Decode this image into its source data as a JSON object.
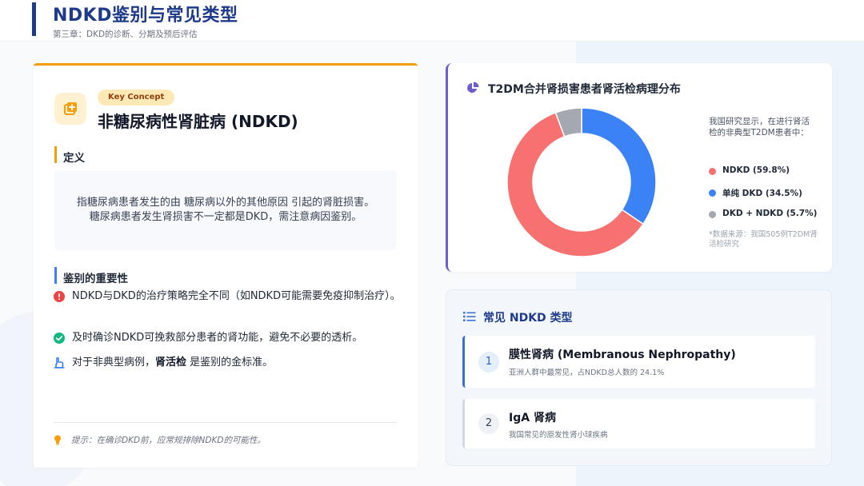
{
  "header": {
    "title": "NDKD鉴别与常见类型",
    "subtitle": "第三章：DKD的诊断、分期及预后评估"
  },
  "concept": {
    "badge": "Key Concept",
    "title": "非糖尿病性肾脏病 (NDKD)",
    "icon": "plus-square-icon"
  },
  "definition": {
    "heading": "定义",
    "line1": "指糖尿病患者发生的由 糖尿病以外的其他原因 引起的肾脏损害。",
    "line2": "糖尿病患者发生肾损害不一定都是DKD，需注意病因鉴别。"
  },
  "importance": {
    "heading": "鉴别的重要性",
    "items": [
      {
        "icon": "exclamation-circle-icon",
        "color": "#ef4444",
        "text": "NDKD与DKD的治疗策略完全不同（如NDKD可能需要免疫抑制治疗）。"
      },
      {
        "icon": "check-circle-icon",
        "color": "#10b981",
        "text": "及时确诊NDKD可挽救部分患者的肾功能，避免不必要的透析。"
      },
      {
        "icon": "hand-pointer-icon",
        "color": "#3b82f6",
        "text_pre": "对于非典型病例，",
        "text_bold": "肾活检",
        "text_post": " 是鉴别的金标准。"
      }
    ]
  },
  "tip": {
    "icon": "lightbulb-icon",
    "text": "提示：在确诊DKD前，应常规排除NDKD的可能性。"
  },
  "chart_card": {
    "title": "T2DM合并肾损害患者肾活检病理分布",
    "icon": "pie-chart-icon",
    "note": "我国研究显示，在进行肾活检的非典型T2DM患者中：",
    "source": "*数据来源：我国505例T2DM肾活检研究"
  },
  "chart_data": {
    "type": "pie",
    "donut": true,
    "title": "T2DM合并肾损害患者肾活检病理分布",
    "categories": [
      "单纯 DKD",
      "NDKD",
      "DKD + NDKD"
    ],
    "values": [
      34.5,
      59.8,
      5.7
    ],
    "legend_labels": [
      "NDKD (59.8%)",
      "单纯 DKD (34.5%)",
      "DKD + NDKD (5.7%)"
    ],
    "colors": [
      "#3b82f6",
      "#f87171",
      "#a3a8b1"
    ],
    "legend_colors": [
      "#f87171",
      "#3b82f6",
      "#a3a8b1"
    ],
    "legend_position": "right"
  },
  "types": {
    "heading": "常见 NDKD 类型",
    "icon": "list-icon",
    "items": [
      {
        "num": "1",
        "name": "膜性肾病 (Membranous Nephropathy)",
        "desc": "亚洲人群中最常见，占NDKD总人数的 24.1%"
      },
      {
        "num": "2",
        "name": "IgA 肾病",
        "desc": "我国常见的原发性肾小球疾病"
      }
    ]
  }
}
